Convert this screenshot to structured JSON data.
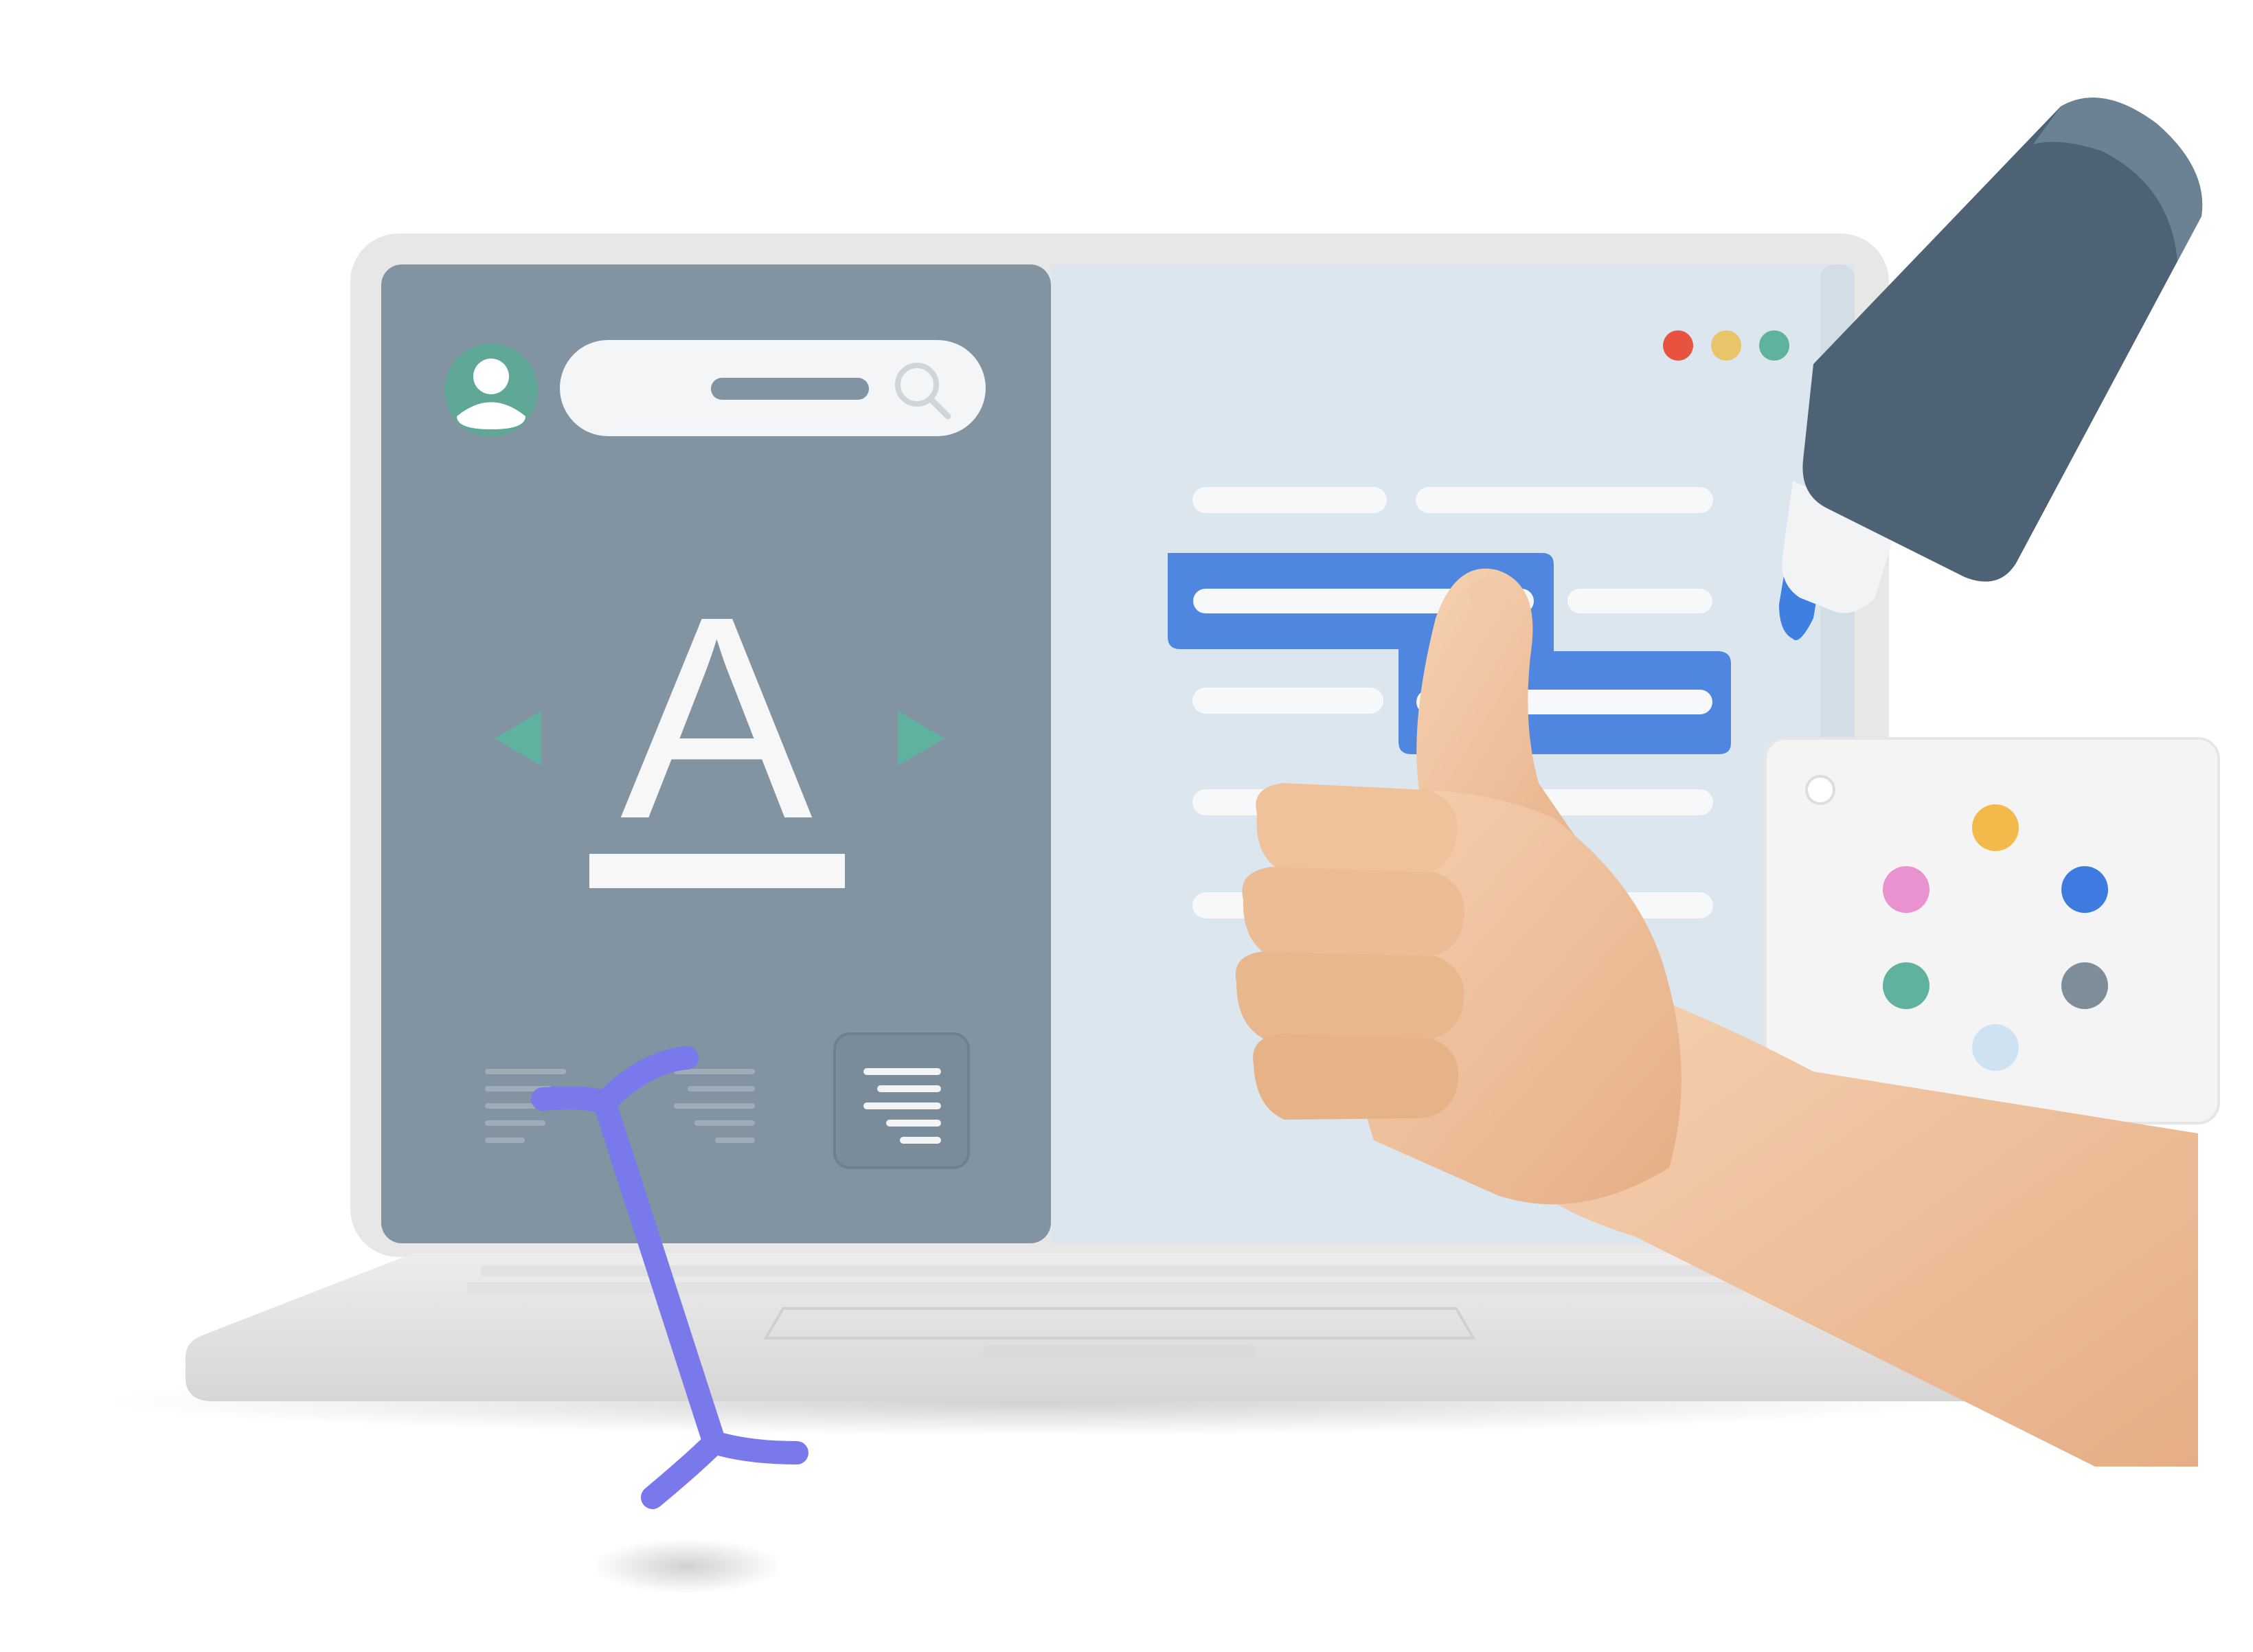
{
  "illustration": {
    "font_glyph": "A",
    "colors": {
      "sidebar": "#8294a2",
      "content": "#dce6ee",
      "selection": "#4f86e0",
      "window_red": "#e8533f",
      "window_yellow": "#e9c56a",
      "window_green": "#5fb2a0",
      "accent_teal": "#5fb2a0",
      "cursor_purple": "#7a79ec",
      "marker_cap": "#4d6274",
      "marker_tip": "#3f7fe0",
      "skin": "#eebf98",
      "swatch_yellow": "#f3b94a",
      "swatch_pink": "#ea91cf",
      "swatch_blue": "#3d7be0",
      "swatch_teal": "#5fb2a0",
      "swatch_gray": "#7d8d99",
      "swatch_lightblue": "#cfe2f2"
    },
    "icons": [
      "user-avatar-icon",
      "search-icon",
      "arrow-left-icon",
      "arrow-right-icon",
      "align-left-icon",
      "align-right-icon",
      "text-cursor-icon",
      "highlighter-marker-icon",
      "thumbs-up-hand-icon",
      "color-palette-icon"
    ]
  }
}
